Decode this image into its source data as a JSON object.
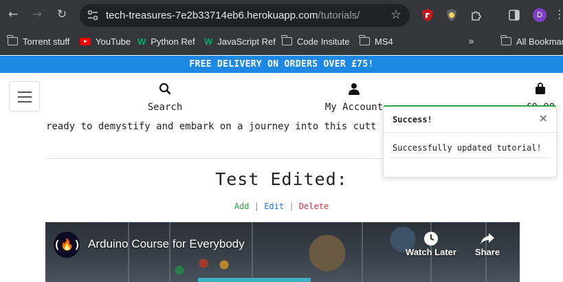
{
  "browser": {
    "url_host": "tech-treasures-7e2b33714eb6.herokuapp.com",
    "url_path": "/tutorials/",
    "profile_initial": "D",
    "bookmarks": [
      {
        "label": "Torrent stuff",
        "icon": "folder-icon"
      },
      {
        "label": "YouTube",
        "icon": "youtube-icon"
      },
      {
        "label": "Python Ref",
        "icon": "w3schools-icon"
      },
      {
        "label": "JavaScript Ref",
        "icon": "w3schools-icon"
      },
      {
        "label": "Code Insitute",
        "icon": "folder-icon"
      },
      {
        "label": "MS4",
        "icon": "folder-icon"
      }
    ],
    "bookmarks_more": "»",
    "all_bookmarks": "All Bookmarks"
  },
  "site": {
    "banner": "FREE DELIVERY ON ORDERS OVER £75!",
    "nav": {
      "search": "Search",
      "account": "My Account",
      "cart_total": "£0.00"
    }
  },
  "content": {
    "intro_fragment": "ready to demystify and embark on a journey into this cutt",
    "tutorial_title": "Test Edited:",
    "actions": {
      "add": "Add",
      "edit": "Edit",
      "delete": "Delete",
      "separator": "|"
    },
    "video": {
      "title": "Arduino Course for Everybody",
      "watch_later": "Watch Later",
      "share": "Share"
    }
  },
  "toast": {
    "title": "Success!",
    "close": "×",
    "message": "Successfully updated tutorial!"
  },
  "colors": {
    "banner": "#1e88e5",
    "success": "#28a745",
    "edit": "#1e73e8",
    "delete": "#dc3545"
  }
}
